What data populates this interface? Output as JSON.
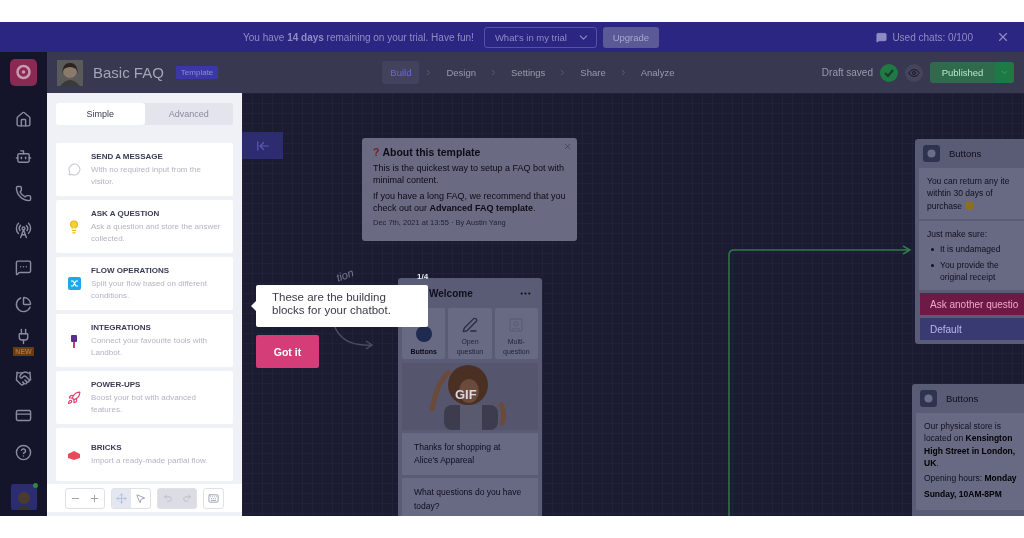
{
  "trial_banner": {
    "text": "You have **14 days** remaining on your trial. Have fun!",
    "dropdown": "What's in my trial",
    "button": "Upgrade",
    "used_chats": "Used chats: 0/100"
  },
  "header": {
    "title": "Basic FAQ",
    "badge": "Template",
    "status": "Draft saved",
    "publish_button": "Published",
    "steps": [
      {
        "label": "Build",
        "selected": true
      },
      {
        "label": "Design",
        "selected": false
      },
      {
        "label": "Settings",
        "selected": false
      },
      {
        "label": "Share",
        "selected": false
      },
      {
        "label": "Analyze",
        "selected": false
      }
    ]
  },
  "rail": {
    "new_badge": "NEW"
  },
  "panel": {
    "tabs": [
      {
        "label": "Simple",
        "selected": true
      },
      {
        "label": "Advanced",
        "selected": false
      }
    ],
    "blocks": [
      {
        "title": "SEND A MESSAGE",
        "description": "With no required input from the visitor."
      },
      {
        "title": "ASK A QUESTION",
        "description": "Ask a question and store the answer collected."
      },
      {
        "title": "FLOW OPERATIONS",
        "description": "Split your flow based on different conditions."
      },
      {
        "title": "INTEGRATIONS",
        "description": "Connect your favourite tools with Landbot."
      },
      {
        "title": "POWER-UPS",
        "description": "Boost your bot with advanced features."
      },
      {
        "title": "BRICKS",
        "description": "Import a ready-made partial flow."
      }
    ]
  },
  "tour": {
    "text": "These are the building blocks for your chatbot.",
    "button": "Got it"
  },
  "canvas": {
    "annotation": "tion",
    "about_card": {
      "mark": "?",
      "title": "About this template",
      "paragraphs": [
        "This is the quickest way to setup a FAQ bot with minimal content.",
        "If you have a long FAQ, we recommend that you check out our **Advanced FAQ template**."
      ],
      "meta": "Dec 7th, 2021 at 13:55 · By Austin Yang"
    },
    "welcome_node": {
      "counter": "1/4",
      "title": "Welcome",
      "options": [
        {
          "label": "Buttons",
          "selected": true
        },
        {
          "label": "Open question",
          "selected": false
        },
        {
          "label": "Multi-question",
          "selected": false
        }
      ],
      "gif_label": "GIF",
      "messages": [
        "Thanks for shopping at Alice's Appareal",
        "What questions do you have today?"
      ]
    },
    "buttons_nodes": [
      {
        "title": "Buttons",
        "message_lines": [
          "You can return any ite",
          "withtin 30 days of",
          "purchase"
        ],
        "intro": "Just make sure:",
        "bullets": [
          "It is undamaged",
          "You provide the original receipt"
        ],
        "choices": [
          {
            "label": "Ask another questio",
            "kind": "primary"
          },
          {
            "label": "Default",
            "kind": "default"
          }
        ]
      },
      {
        "title": "Buttons",
        "paragraphs": [
          "Our physical store is located on **Kensington High Street in London, UK**.",
          "Opening hours: **Monday**",
          "**Sunday, 10AM-8PM**"
        ]
      }
    ]
  }
}
